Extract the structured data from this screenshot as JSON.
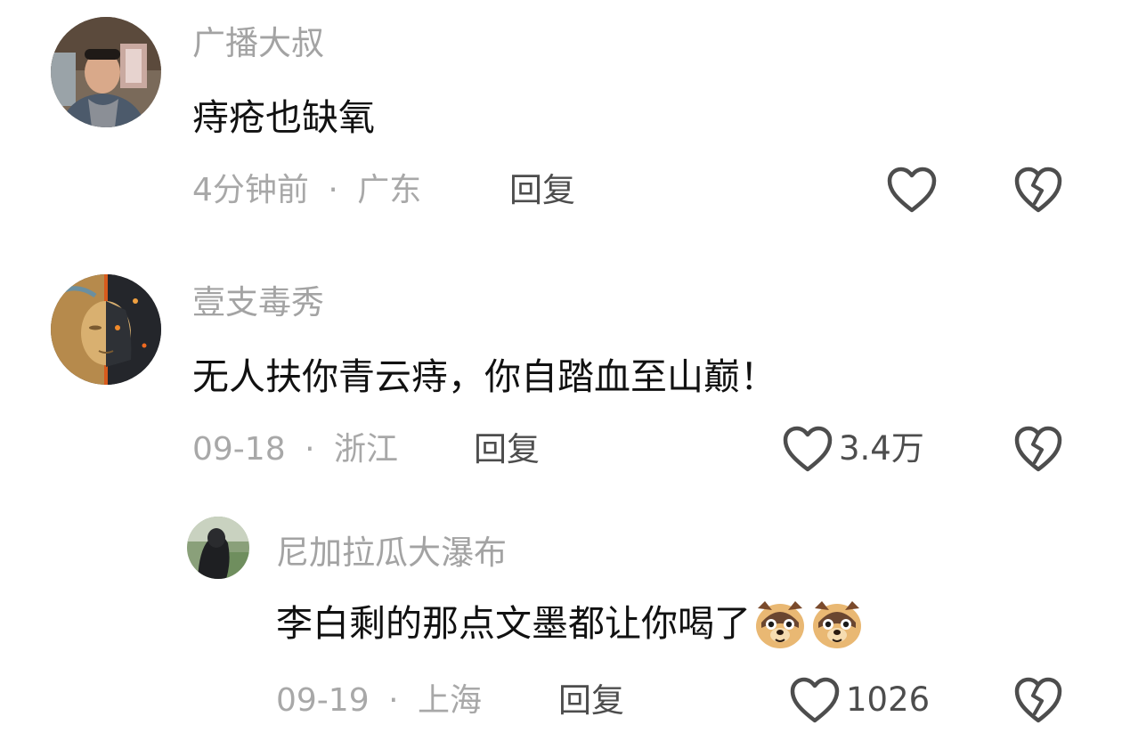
{
  "comments": [
    {
      "username": "广播大叔",
      "text": "痔疮也缺氧",
      "time": "4分钟前",
      "separator": "·",
      "location": "广东",
      "reply_label": "回复",
      "like_count": ""
    },
    {
      "username": "壹支毒秀",
      "text": "无人扶你青云痔，你自踏血至山巅！",
      "time": "09-18",
      "separator": "·",
      "location": "浙江",
      "reply_label": "回复",
      "like_count": "3.4万"
    }
  ],
  "reply_comment": {
    "username": "尼加拉瓜大瀑布",
    "text": "李白剩的那点文墨都让你喝了",
    "emoji": [
      "dog-face-emoji",
      "dog-face-emoji"
    ],
    "time": "09-19",
    "separator": "·",
    "location": "上海",
    "reply_label": "回复",
    "like_count": "1026"
  },
  "icons": {
    "like": "heart-outline-icon",
    "dislike": "broken-heart-icon"
  },
  "colors": {
    "username": "#a3a3a3",
    "text": "#111111",
    "meta": "#a8a8a8",
    "action": "#4d4d4d"
  }
}
